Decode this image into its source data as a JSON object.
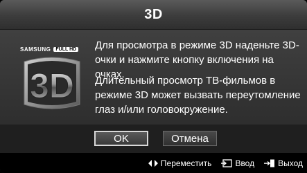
{
  "dialog": {
    "title": "3D",
    "logo": {
      "brand": "SAMSUNG",
      "badge": "FULL HD",
      "mark": "3D"
    },
    "message_1": "Для просмотра в режиме 3D наденьте 3D-очки и нажмите кнопку включения на очках.",
    "message_2": "Длительный просмотр ТВ-фильмов в режиме 3D может вызвать переутомление глаз и/или головокружение.",
    "buttons": {
      "ok": "OK",
      "cancel": "Отмена"
    }
  },
  "footer": {
    "move": {
      "icon": "left-right-arrows-icon",
      "label": "Переместить"
    },
    "enter": {
      "icon": "enter-icon",
      "label": "Ввод"
    },
    "exit": {
      "icon": "exit-icon",
      "label": "Выход"
    }
  },
  "colors": {
    "background": "#2e2e2e",
    "title_bar": "#3c3c3c",
    "button_bar": "#1f1f1f",
    "focus_border": "#d8d8d8",
    "text": "#ffffff"
  }
}
